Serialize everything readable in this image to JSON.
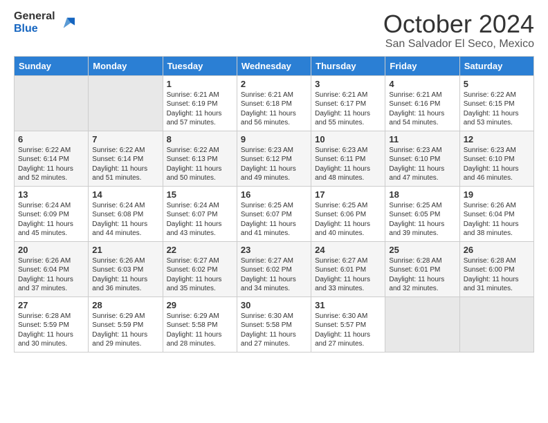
{
  "logo": {
    "general": "General",
    "blue": "Blue"
  },
  "title": "October 2024",
  "location": "San Salvador El Seco, Mexico",
  "days_of_week": [
    "Sunday",
    "Monday",
    "Tuesday",
    "Wednesday",
    "Thursday",
    "Friday",
    "Saturday"
  ],
  "weeks": [
    [
      {
        "day": "",
        "sunrise": "",
        "sunset": "",
        "daylight": ""
      },
      {
        "day": "",
        "sunrise": "",
        "sunset": "",
        "daylight": ""
      },
      {
        "day": "1",
        "sunrise": "Sunrise: 6:21 AM",
        "sunset": "Sunset: 6:19 PM",
        "daylight": "Daylight: 11 hours and 57 minutes."
      },
      {
        "day": "2",
        "sunrise": "Sunrise: 6:21 AM",
        "sunset": "Sunset: 6:18 PM",
        "daylight": "Daylight: 11 hours and 56 minutes."
      },
      {
        "day": "3",
        "sunrise": "Sunrise: 6:21 AM",
        "sunset": "Sunset: 6:17 PM",
        "daylight": "Daylight: 11 hours and 55 minutes."
      },
      {
        "day": "4",
        "sunrise": "Sunrise: 6:21 AM",
        "sunset": "Sunset: 6:16 PM",
        "daylight": "Daylight: 11 hours and 54 minutes."
      },
      {
        "day": "5",
        "sunrise": "Sunrise: 6:22 AM",
        "sunset": "Sunset: 6:15 PM",
        "daylight": "Daylight: 11 hours and 53 minutes."
      }
    ],
    [
      {
        "day": "6",
        "sunrise": "Sunrise: 6:22 AM",
        "sunset": "Sunset: 6:14 PM",
        "daylight": "Daylight: 11 hours and 52 minutes."
      },
      {
        "day": "7",
        "sunrise": "Sunrise: 6:22 AM",
        "sunset": "Sunset: 6:14 PM",
        "daylight": "Daylight: 11 hours and 51 minutes."
      },
      {
        "day": "8",
        "sunrise": "Sunrise: 6:22 AM",
        "sunset": "Sunset: 6:13 PM",
        "daylight": "Daylight: 11 hours and 50 minutes."
      },
      {
        "day": "9",
        "sunrise": "Sunrise: 6:23 AM",
        "sunset": "Sunset: 6:12 PM",
        "daylight": "Daylight: 11 hours and 49 minutes."
      },
      {
        "day": "10",
        "sunrise": "Sunrise: 6:23 AM",
        "sunset": "Sunset: 6:11 PM",
        "daylight": "Daylight: 11 hours and 48 minutes."
      },
      {
        "day": "11",
        "sunrise": "Sunrise: 6:23 AM",
        "sunset": "Sunset: 6:10 PM",
        "daylight": "Daylight: 11 hours and 47 minutes."
      },
      {
        "day": "12",
        "sunrise": "Sunrise: 6:23 AM",
        "sunset": "Sunset: 6:10 PM",
        "daylight": "Daylight: 11 hours and 46 minutes."
      }
    ],
    [
      {
        "day": "13",
        "sunrise": "Sunrise: 6:24 AM",
        "sunset": "Sunset: 6:09 PM",
        "daylight": "Daylight: 11 hours and 45 minutes."
      },
      {
        "day": "14",
        "sunrise": "Sunrise: 6:24 AM",
        "sunset": "Sunset: 6:08 PM",
        "daylight": "Daylight: 11 hours and 44 minutes."
      },
      {
        "day": "15",
        "sunrise": "Sunrise: 6:24 AM",
        "sunset": "Sunset: 6:07 PM",
        "daylight": "Daylight: 11 hours and 43 minutes."
      },
      {
        "day": "16",
        "sunrise": "Sunrise: 6:25 AM",
        "sunset": "Sunset: 6:07 PM",
        "daylight": "Daylight: 11 hours and 41 minutes."
      },
      {
        "day": "17",
        "sunrise": "Sunrise: 6:25 AM",
        "sunset": "Sunset: 6:06 PM",
        "daylight": "Daylight: 11 hours and 40 minutes."
      },
      {
        "day": "18",
        "sunrise": "Sunrise: 6:25 AM",
        "sunset": "Sunset: 6:05 PM",
        "daylight": "Daylight: 11 hours and 39 minutes."
      },
      {
        "day": "19",
        "sunrise": "Sunrise: 6:26 AM",
        "sunset": "Sunset: 6:04 PM",
        "daylight": "Daylight: 11 hours and 38 minutes."
      }
    ],
    [
      {
        "day": "20",
        "sunrise": "Sunrise: 6:26 AM",
        "sunset": "Sunset: 6:04 PM",
        "daylight": "Daylight: 11 hours and 37 minutes."
      },
      {
        "day": "21",
        "sunrise": "Sunrise: 6:26 AM",
        "sunset": "Sunset: 6:03 PM",
        "daylight": "Daylight: 11 hours and 36 minutes."
      },
      {
        "day": "22",
        "sunrise": "Sunrise: 6:27 AM",
        "sunset": "Sunset: 6:02 PM",
        "daylight": "Daylight: 11 hours and 35 minutes."
      },
      {
        "day": "23",
        "sunrise": "Sunrise: 6:27 AM",
        "sunset": "Sunset: 6:02 PM",
        "daylight": "Daylight: 11 hours and 34 minutes."
      },
      {
        "day": "24",
        "sunrise": "Sunrise: 6:27 AM",
        "sunset": "Sunset: 6:01 PM",
        "daylight": "Daylight: 11 hours and 33 minutes."
      },
      {
        "day": "25",
        "sunrise": "Sunrise: 6:28 AM",
        "sunset": "Sunset: 6:01 PM",
        "daylight": "Daylight: 11 hours and 32 minutes."
      },
      {
        "day": "26",
        "sunrise": "Sunrise: 6:28 AM",
        "sunset": "Sunset: 6:00 PM",
        "daylight": "Daylight: 11 hours and 31 minutes."
      }
    ],
    [
      {
        "day": "27",
        "sunrise": "Sunrise: 6:28 AM",
        "sunset": "Sunset: 5:59 PM",
        "daylight": "Daylight: 11 hours and 30 minutes."
      },
      {
        "day": "28",
        "sunrise": "Sunrise: 6:29 AM",
        "sunset": "Sunset: 5:59 PM",
        "daylight": "Daylight: 11 hours and 29 minutes."
      },
      {
        "day": "29",
        "sunrise": "Sunrise: 6:29 AM",
        "sunset": "Sunset: 5:58 PM",
        "daylight": "Daylight: 11 hours and 28 minutes."
      },
      {
        "day": "30",
        "sunrise": "Sunrise: 6:30 AM",
        "sunset": "Sunset: 5:58 PM",
        "daylight": "Daylight: 11 hours and 27 minutes."
      },
      {
        "day": "31",
        "sunrise": "Sunrise: 6:30 AM",
        "sunset": "Sunset: 5:57 PM",
        "daylight": "Daylight: 11 hours and 27 minutes."
      },
      {
        "day": "",
        "sunrise": "",
        "sunset": "",
        "daylight": ""
      },
      {
        "day": "",
        "sunrise": "",
        "sunset": "",
        "daylight": ""
      }
    ]
  ]
}
